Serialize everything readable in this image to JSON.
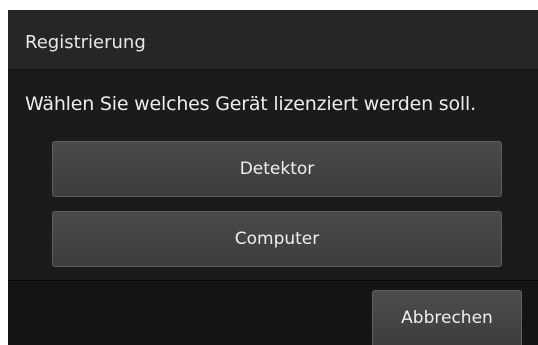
{
  "dialog": {
    "title": "Registrierung",
    "prompt": "Wählen Sie welches Gerät lizenziert werden soll.",
    "options": [
      {
        "label": "Detektor"
      },
      {
        "label": "Computer"
      }
    ],
    "cancel_label": "Abbrechen"
  },
  "colors": {
    "background": "#1b1b1b",
    "title_bar": "#262626",
    "button": "#434343",
    "text": "#eeeeee"
  }
}
